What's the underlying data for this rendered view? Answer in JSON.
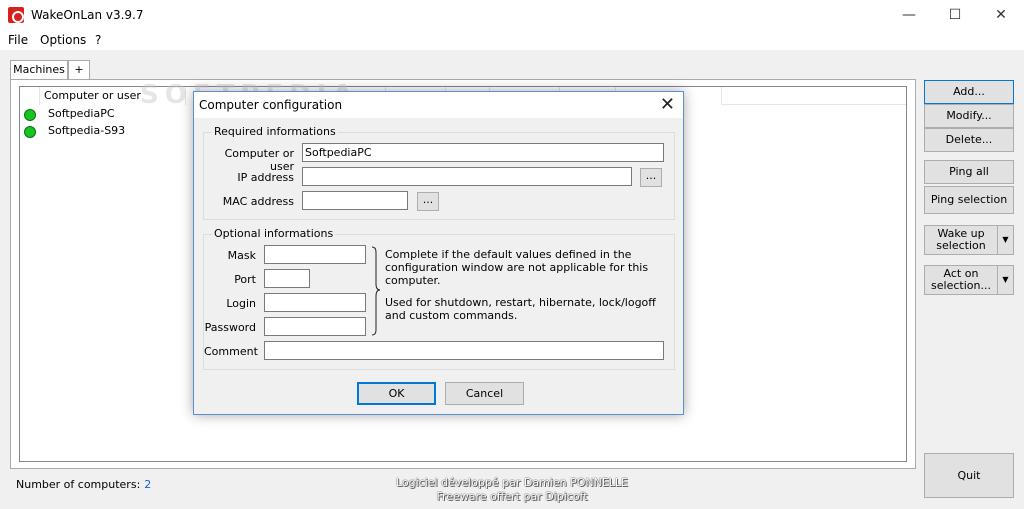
{
  "window": {
    "title": "WakeOnLan v3.9.7",
    "minimize": "—",
    "maximize": "☐",
    "close": "✕"
  },
  "menu": [
    "File",
    "Options",
    "?"
  ],
  "tabs": [
    "Machines",
    "+"
  ],
  "list": {
    "column": "Computer or user",
    "rows": [
      {
        "name": "SoftpediaPC",
        "status_color": "#14c61f"
      },
      {
        "name": "Softpedia-S93",
        "status_color": "#14c61f"
      }
    ]
  },
  "side_buttons": {
    "add": "Add...",
    "modify": "Modify...",
    "delete": "Delete...",
    "ping_all": "Ping all",
    "ping_selection": "Ping selection",
    "wake_line1": "Wake up",
    "wake_line2": "selection",
    "act_line1": "Act on",
    "act_line2": "selection...",
    "quit": "Quit"
  },
  "status": {
    "label": "Number of computers:",
    "count": "2"
  },
  "credits": {
    "line1": "Logiciel développé par Damien PONNELLE",
    "line2": "Freeware offert par Dipicoft"
  },
  "watermark": "SOFTPEDIA",
  "dialog": {
    "title": "Computer configuration",
    "required_group": "Required informations",
    "computer_label": "Computer or user",
    "computer_value": "SoftpediaPC",
    "ip_label": "IP address",
    "ip_value": "",
    "mac_label": "MAC address",
    "mac_value": "",
    "browse": "...",
    "optional_group": "Optional informations",
    "mask_label": "Mask",
    "port_label": "Port",
    "login_label": "Login",
    "password_label": "Password",
    "comment_label": "Comment",
    "note1": "Complete if the default values defined in the configuration window are not applicable for this computer.",
    "note2": "Used for shutdown, restart, hibernate, lock/logoff and custom commands.",
    "ok": "OK",
    "cancel": "Cancel"
  }
}
